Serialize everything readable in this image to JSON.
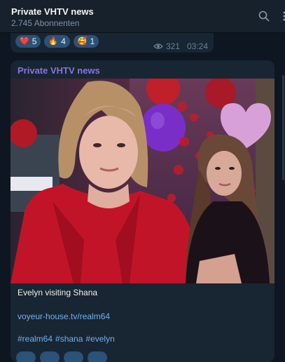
{
  "header": {
    "title": "Private VHTV news",
    "subscribers": "2.745 Abonnenten"
  },
  "prev_message": {
    "reactions": [
      {
        "emoji": "❤️",
        "count": "5"
      },
      {
        "emoji": "🔥",
        "count": "4"
      },
      {
        "emoji": "🥰",
        "count": "1"
      }
    ],
    "views": "321",
    "time": "03:24"
  },
  "post": {
    "channel": "Private VHTV news",
    "caption": "Evelyn visiting Shana",
    "link": "voyeur-house.tv/realm64",
    "tags": [
      "#realm64",
      "#shana",
      "#evelyn"
    ]
  },
  "colors": {
    "background": "#0e1621",
    "header": "#17212b",
    "bubble": "#182533",
    "reaction": "#2b5278",
    "link": "#6ab3f3",
    "channel_name": "#8774e1"
  },
  "icons": {
    "search": "search-icon",
    "more": "more-vertical-icon",
    "views": "eye-icon"
  }
}
